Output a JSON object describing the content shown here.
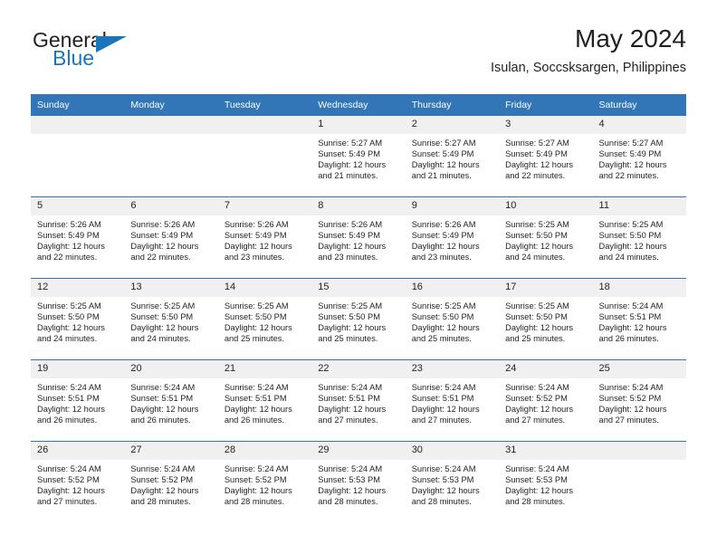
{
  "brand": {
    "name_part1": "General",
    "name_part2": "Blue",
    "logo_icon": "triangle-icon"
  },
  "header": {
    "month_title": "May 2024",
    "location": "Isulan, Soccsksargen, Philippines"
  },
  "calendar": {
    "weekday_headers": [
      "Sunday",
      "Monday",
      "Tuesday",
      "Wednesday",
      "Thursday",
      "Friday",
      "Saturday"
    ],
    "header_bg_color": "#3276b8",
    "daynum_bg_color": "#f0f0f0",
    "weeks": [
      [
        {
          "day": "",
          "sunrise": "",
          "sunset": "",
          "daylight_line1": "",
          "daylight_line2": ""
        },
        {
          "day": "",
          "sunrise": "",
          "sunset": "",
          "daylight_line1": "",
          "daylight_line2": ""
        },
        {
          "day": "",
          "sunrise": "",
          "sunset": "",
          "daylight_line1": "",
          "daylight_line2": ""
        },
        {
          "day": "1",
          "sunrise": "Sunrise: 5:27 AM",
          "sunset": "Sunset: 5:49 PM",
          "daylight_line1": "Daylight: 12 hours",
          "daylight_line2": "and 21 minutes."
        },
        {
          "day": "2",
          "sunrise": "Sunrise: 5:27 AM",
          "sunset": "Sunset: 5:49 PM",
          "daylight_line1": "Daylight: 12 hours",
          "daylight_line2": "and 21 minutes."
        },
        {
          "day": "3",
          "sunrise": "Sunrise: 5:27 AM",
          "sunset": "Sunset: 5:49 PM",
          "daylight_line1": "Daylight: 12 hours",
          "daylight_line2": "and 22 minutes."
        },
        {
          "day": "4",
          "sunrise": "Sunrise: 5:27 AM",
          "sunset": "Sunset: 5:49 PM",
          "daylight_line1": "Daylight: 12 hours",
          "daylight_line2": "and 22 minutes."
        }
      ],
      [
        {
          "day": "5",
          "sunrise": "Sunrise: 5:26 AM",
          "sunset": "Sunset: 5:49 PM",
          "daylight_line1": "Daylight: 12 hours",
          "daylight_line2": "and 22 minutes."
        },
        {
          "day": "6",
          "sunrise": "Sunrise: 5:26 AM",
          "sunset": "Sunset: 5:49 PM",
          "daylight_line1": "Daylight: 12 hours",
          "daylight_line2": "and 22 minutes."
        },
        {
          "day": "7",
          "sunrise": "Sunrise: 5:26 AM",
          "sunset": "Sunset: 5:49 PM",
          "daylight_line1": "Daylight: 12 hours",
          "daylight_line2": "and 23 minutes."
        },
        {
          "day": "8",
          "sunrise": "Sunrise: 5:26 AM",
          "sunset": "Sunset: 5:49 PM",
          "daylight_line1": "Daylight: 12 hours",
          "daylight_line2": "and 23 minutes."
        },
        {
          "day": "9",
          "sunrise": "Sunrise: 5:26 AM",
          "sunset": "Sunset: 5:49 PM",
          "daylight_line1": "Daylight: 12 hours",
          "daylight_line2": "and 23 minutes."
        },
        {
          "day": "10",
          "sunrise": "Sunrise: 5:25 AM",
          "sunset": "Sunset: 5:50 PM",
          "daylight_line1": "Daylight: 12 hours",
          "daylight_line2": "and 24 minutes."
        },
        {
          "day": "11",
          "sunrise": "Sunrise: 5:25 AM",
          "sunset": "Sunset: 5:50 PM",
          "daylight_line1": "Daylight: 12 hours",
          "daylight_line2": "and 24 minutes."
        }
      ],
      [
        {
          "day": "12",
          "sunrise": "Sunrise: 5:25 AM",
          "sunset": "Sunset: 5:50 PM",
          "daylight_line1": "Daylight: 12 hours",
          "daylight_line2": "and 24 minutes."
        },
        {
          "day": "13",
          "sunrise": "Sunrise: 5:25 AM",
          "sunset": "Sunset: 5:50 PM",
          "daylight_line1": "Daylight: 12 hours",
          "daylight_line2": "and 24 minutes."
        },
        {
          "day": "14",
          "sunrise": "Sunrise: 5:25 AM",
          "sunset": "Sunset: 5:50 PM",
          "daylight_line1": "Daylight: 12 hours",
          "daylight_line2": "and 25 minutes."
        },
        {
          "day": "15",
          "sunrise": "Sunrise: 5:25 AM",
          "sunset": "Sunset: 5:50 PM",
          "daylight_line1": "Daylight: 12 hours",
          "daylight_line2": "and 25 minutes."
        },
        {
          "day": "16",
          "sunrise": "Sunrise: 5:25 AM",
          "sunset": "Sunset: 5:50 PM",
          "daylight_line1": "Daylight: 12 hours",
          "daylight_line2": "and 25 minutes."
        },
        {
          "day": "17",
          "sunrise": "Sunrise: 5:25 AM",
          "sunset": "Sunset: 5:50 PM",
          "daylight_line1": "Daylight: 12 hours",
          "daylight_line2": "and 25 minutes."
        },
        {
          "day": "18",
          "sunrise": "Sunrise: 5:24 AM",
          "sunset": "Sunset: 5:51 PM",
          "daylight_line1": "Daylight: 12 hours",
          "daylight_line2": "and 26 minutes."
        }
      ],
      [
        {
          "day": "19",
          "sunrise": "Sunrise: 5:24 AM",
          "sunset": "Sunset: 5:51 PM",
          "daylight_line1": "Daylight: 12 hours",
          "daylight_line2": "and 26 minutes."
        },
        {
          "day": "20",
          "sunrise": "Sunrise: 5:24 AM",
          "sunset": "Sunset: 5:51 PM",
          "daylight_line1": "Daylight: 12 hours",
          "daylight_line2": "and 26 minutes."
        },
        {
          "day": "21",
          "sunrise": "Sunrise: 5:24 AM",
          "sunset": "Sunset: 5:51 PM",
          "daylight_line1": "Daylight: 12 hours",
          "daylight_line2": "and 26 minutes."
        },
        {
          "day": "22",
          "sunrise": "Sunrise: 5:24 AM",
          "sunset": "Sunset: 5:51 PM",
          "daylight_line1": "Daylight: 12 hours",
          "daylight_line2": "and 27 minutes."
        },
        {
          "day": "23",
          "sunrise": "Sunrise: 5:24 AM",
          "sunset": "Sunset: 5:51 PM",
          "daylight_line1": "Daylight: 12 hours",
          "daylight_line2": "and 27 minutes."
        },
        {
          "day": "24",
          "sunrise": "Sunrise: 5:24 AM",
          "sunset": "Sunset: 5:52 PM",
          "daylight_line1": "Daylight: 12 hours",
          "daylight_line2": "and 27 minutes."
        },
        {
          "day": "25",
          "sunrise": "Sunrise: 5:24 AM",
          "sunset": "Sunset: 5:52 PM",
          "daylight_line1": "Daylight: 12 hours",
          "daylight_line2": "and 27 minutes."
        }
      ],
      [
        {
          "day": "26",
          "sunrise": "Sunrise: 5:24 AM",
          "sunset": "Sunset: 5:52 PM",
          "daylight_line1": "Daylight: 12 hours",
          "daylight_line2": "and 27 minutes."
        },
        {
          "day": "27",
          "sunrise": "Sunrise: 5:24 AM",
          "sunset": "Sunset: 5:52 PM",
          "daylight_line1": "Daylight: 12 hours",
          "daylight_line2": "and 28 minutes."
        },
        {
          "day": "28",
          "sunrise": "Sunrise: 5:24 AM",
          "sunset": "Sunset: 5:52 PM",
          "daylight_line1": "Daylight: 12 hours",
          "daylight_line2": "and 28 minutes."
        },
        {
          "day": "29",
          "sunrise": "Sunrise: 5:24 AM",
          "sunset": "Sunset: 5:53 PM",
          "daylight_line1": "Daylight: 12 hours",
          "daylight_line2": "and 28 minutes."
        },
        {
          "day": "30",
          "sunrise": "Sunrise: 5:24 AM",
          "sunset": "Sunset: 5:53 PM",
          "daylight_line1": "Daylight: 12 hours",
          "daylight_line2": "and 28 minutes."
        },
        {
          "day": "31",
          "sunrise": "Sunrise: 5:24 AM",
          "sunset": "Sunset: 5:53 PM",
          "daylight_line1": "Daylight: 12 hours",
          "daylight_line2": "and 28 minutes."
        },
        {
          "day": "",
          "sunrise": "",
          "sunset": "",
          "daylight_line1": "",
          "daylight_line2": ""
        }
      ]
    ]
  }
}
